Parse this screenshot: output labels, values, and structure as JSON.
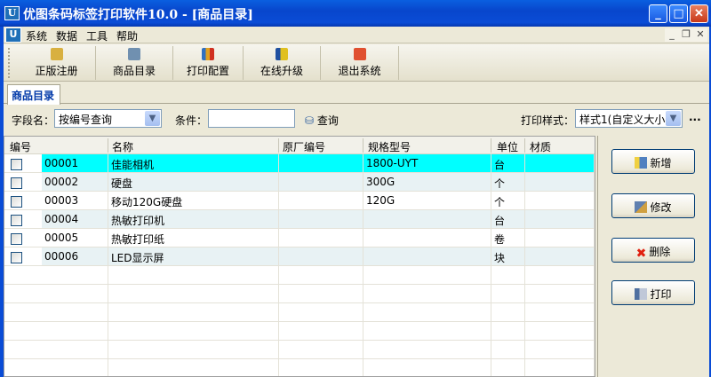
{
  "window": {
    "title": "优图条码标签打印软件10.0 - [商品目录]",
    "logo": "U"
  },
  "menu": [
    "系统",
    "数据",
    "工具",
    "帮助"
  ],
  "toolbar": [
    "正版注册",
    "商品目录",
    "打印配置",
    "在线升级",
    "退出系统"
  ],
  "tab": "商品目录",
  "filter": {
    "field_label": "字段名：",
    "field_value": "按编号查询",
    "cond_label": "条件：",
    "cond_value": "",
    "query": "查询",
    "style_label": "打印样式：",
    "style_value": "样式1(自定义大小)",
    "more": "..."
  },
  "columns": [
    "编号",
    "名称",
    "原厂编号",
    "规格型号",
    "单位",
    "材质"
  ],
  "rows": [
    [
      "00001",
      "佳能相机",
      "",
      "1800-UYT",
      "台",
      ""
    ],
    [
      "00002",
      "硬盘",
      "",
      "300G",
      "个",
      ""
    ],
    [
      "00003",
      "移动120G硬盘",
      "",
      "120G",
      "个",
      ""
    ],
    [
      "00004",
      "热敏打印机",
      "",
      "",
      "台",
      ""
    ],
    [
      "00005",
      "热敏打印纸",
      "",
      "",
      "卷",
      ""
    ],
    [
      "00006",
      "LED显示屏",
      "",
      "",
      "块",
      ""
    ]
  ],
  "actions": [
    "新增",
    "修改",
    "删除",
    "打印"
  ],
  "colors": {
    "selected": "#00ffff",
    "alt": "#e8f2f4",
    "titlebar": "#0a4cd6"
  }
}
